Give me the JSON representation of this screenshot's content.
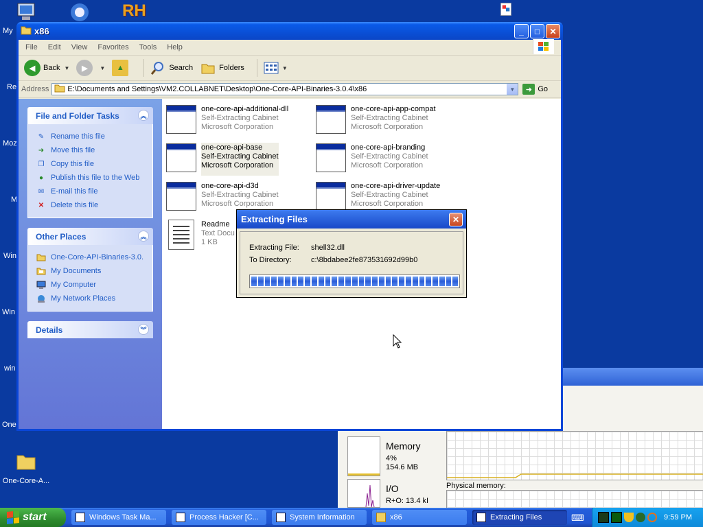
{
  "desktop": {
    "edge_labels": [
      "My",
      "Re",
      "Moz",
      "M",
      "Win",
      "Win",
      "win",
      "One"
    ],
    "rh_label": "RH",
    "folder_label": "One-Core-A..."
  },
  "explorer": {
    "title": "x86",
    "menu": [
      "File",
      "Edit",
      "View",
      "Favorites",
      "Tools",
      "Help"
    ],
    "toolbar": {
      "back": "Back",
      "search": "Search",
      "folders": "Folders"
    },
    "address": {
      "label": "Address",
      "value": "E:\\Documents and Settings\\VM2.COLLABNET\\Desktop\\One-Core-API-Binaries-3.0.4\\x86",
      "go": "Go"
    },
    "tasks_panel": {
      "title": "File and Folder Tasks",
      "items": [
        "Rename this file",
        "Move this file",
        "Copy this file",
        "Publish this file to the Web",
        "E-mail this file",
        "Delete this file"
      ]
    },
    "places_panel": {
      "title": "Other Places",
      "items": [
        "One-Core-API-Binaries-3.0.",
        "My Documents",
        "My Computer",
        "My Network Places"
      ]
    },
    "details_panel": {
      "title": "Details"
    },
    "files": [
      {
        "name": "one-core-api-additional-dll",
        "type": "Self-Extracting Cabinet",
        "company": "Microsoft Corporation"
      },
      {
        "name": "one-core-api-app-compat",
        "type": "Self-Extracting Cabinet",
        "company": "Microsoft Corporation"
      },
      {
        "name": "one-core-api-base",
        "type": "Self-Extracting Cabinet",
        "company": "Microsoft Corporation"
      },
      {
        "name": "one-core-api-branding",
        "type": "Self-Extracting Cabinet",
        "company": "Microsoft Corporation"
      },
      {
        "name": "one-core-api-d3d",
        "type": "Self-Extracting Cabinet",
        "company": "Microsoft Corporation"
      },
      {
        "name": "one-core-api-driver-update",
        "type": "Self-Extracting Cabinet",
        "company": "Microsoft Corporation"
      },
      {
        "name": "Readme",
        "type": "Text Docu",
        "company": "1 KB"
      }
    ]
  },
  "dialog": {
    "title": "Extracting Files",
    "file_label": "Extracting File:",
    "file_value": "shell32.dll",
    "dir_label": "To Directory:",
    "dir_value": "c:\\8bdabee2fe873531692d99b0",
    "progress": 1.0
  },
  "taskmgr": {
    "memory_label": "Memory",
    "memory_pct": "4%",
    "memory_size": "154.6 MB",
    "io_label": "I/O",
    "io_value": "R+O: 13.4 kI",
    "physical_memory_label": "Physical memory:"
  },
  "taskbar": {
    "start": "start",
    "buttons": [
      "Windows Task Ma...",
      "Process Hacker [C...",
      "System Information",
      "x86",
      "Extracting Files"
    ],
    "active_index": 4,
    "clock": "9:59 PM"
  },
  "colors": {
    "desktop": "#0a3aa0",
    "xp_blue": "#0a46d8",
    "link_blue": "#215dc6",
    "start_green": "#2e8b2e"
  }
}
